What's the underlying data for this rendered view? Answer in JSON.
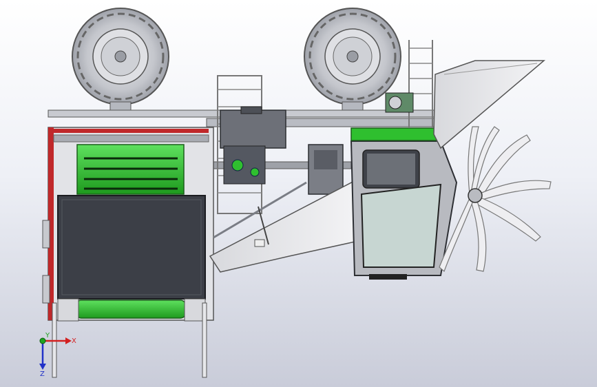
{
  "triad": {
    "x_label": "X",
    "y_label": "Y",
    "z_label": "Z",
    "x_color": "#d32020",
    "y_color": "#1fa31f",
    "z_color": "#2030c8"
  },
  "colors": {
    "accent_green": "#2fbf2f",
    "frame_red": "#c0282a",
    "tire_gray": "#cfd1d6",
    "steel": "#8a8f98",
    "dark_panel": "#3c3f47"
  }
}
